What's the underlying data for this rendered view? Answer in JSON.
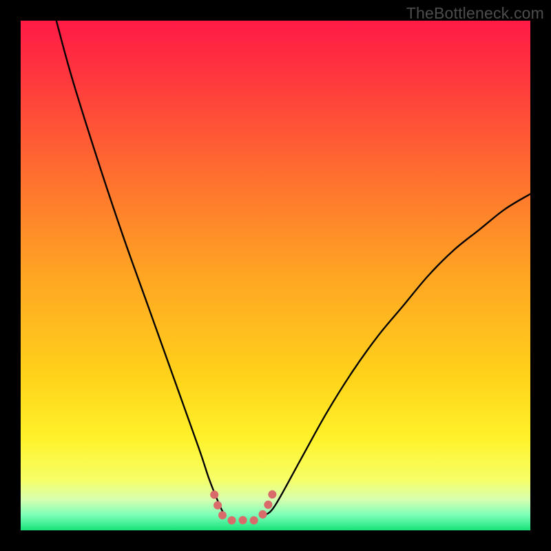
{
  "watermark": "TheBottleneck.com",
  "gradient_colors": {
    "c0": "#ff1a46",
    "c1": "#ff3a3d",
    "c2": "#ff6e2f",
    "c3": "#ffa523",
    "c4": "#ffd31a",
    "c5": "#fff22a",
    "c6": "#f7ff66",
    "c7": "#d6ffb0",
    "c8": "#7dffb8",
    "c9": "#16e27a"
  },
  "chart_data": {
    "type": "line",
    "title": "",
    "xlabel": "",
    "ylabel": "",
    "xlim": [
      0,
      100
    ],
    "ylim": [
      0,
      100
    ],
    "grid": false,
    "series": [
      {
        "name": "left-arm",
        "stroke": "#000000",
        "stroke_width": 2.4,
        "x": [
          7,
          10,
          15,
          20,
          25,
          30,
          35,
          37,
          39,
          40
        ],
        "y": [
          100,
          89,
          73,
          58,
          44,
          30,
          16,
          10,
          5,
          3
        ]
      },
      {
        "name": "right-arm",
        "stroke": "#000000",
        "stroke_width": 2.4,
        "x": [
          48,
          50,
          55,
          60,
          65,
          70,
          75,
          80,
          85,
          90,
          95,
          100
        ],
        "y": [
          3,
          5,
          14,
          23,
          31,
          38,
          44,
          50,
          55,
          59,
          63,
          66
        ]
      },
      {
        "name": "valley-highlight",
        "stroke": "#d96b6b",
        "stroke_width": 12,
        "dotted": true,
        "x": [
          38,
          39,
          40,
          41,
          42,
          43,
          44,
          45,
          46,
          47,
          48,
          49,
          50
        ],
        "y": [
          7,
          4,
          2.5,
          2,
          2,
          2,
          2,
          2,
          2,
          2.5,
          4,
          6,
          9
        ]
      }
    ]
  }
}
